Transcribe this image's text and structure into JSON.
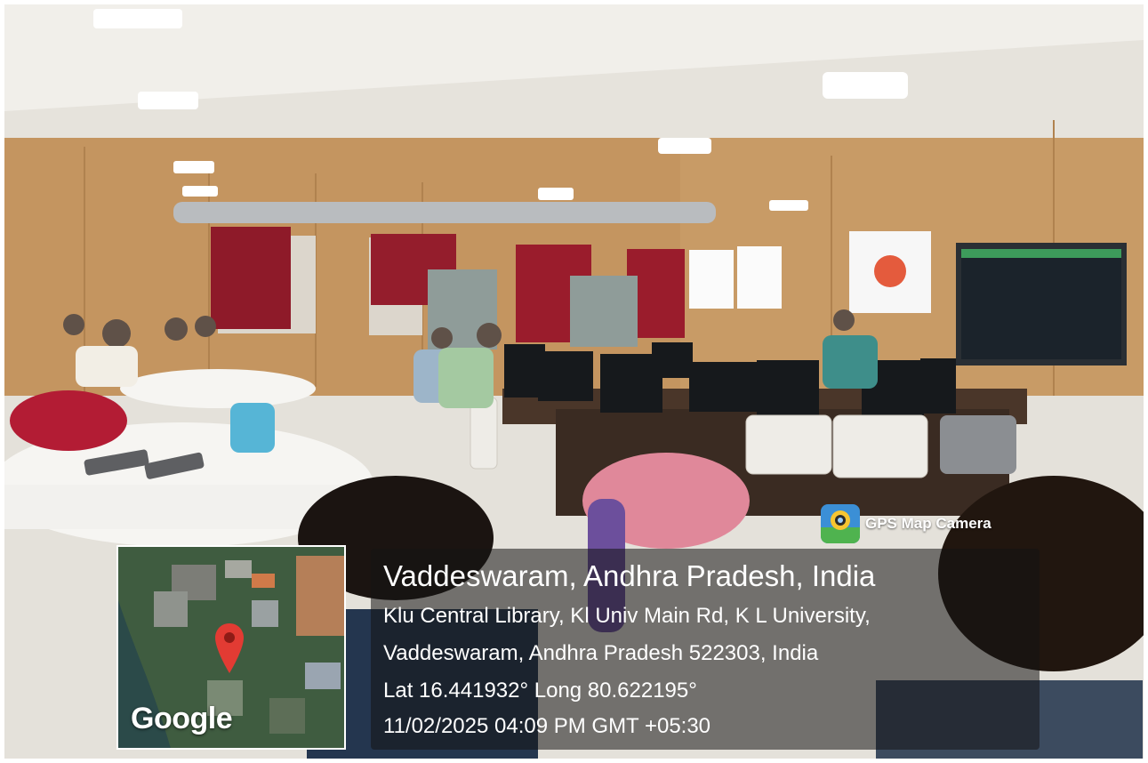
{
  "photo": {
    "description_icon": "photo-scene",
    "colors": {
      "wall": "#c99a63",
      "ceiling": "#f3f1ec",
      "curtain": "#9b1c2c",
      "screen": "#1f2a33",
      "overlay": "#141414"
    }
  },
  "stamp": {
    "brand": "GPS Map Camera",
    "title": "Vaddeswaram, Andhra Pradesh, India",
    "address_line1": "Klu Central Library, Kl Univ Main Rd, K L University,",
    "address_line2": "Vaddeswaram, Andhra Pradesh 522303, India",
    "coords": "Lat 16.441932° Long 80.622195°",
    "timestamp": "11/02/2025 04:09 PM GMT +05:30",
    "map_logo": "Google",
    "map_pin_icon": "map-pin-icon",
    "brand_icon": "camera-pin-icon"
  }
}
